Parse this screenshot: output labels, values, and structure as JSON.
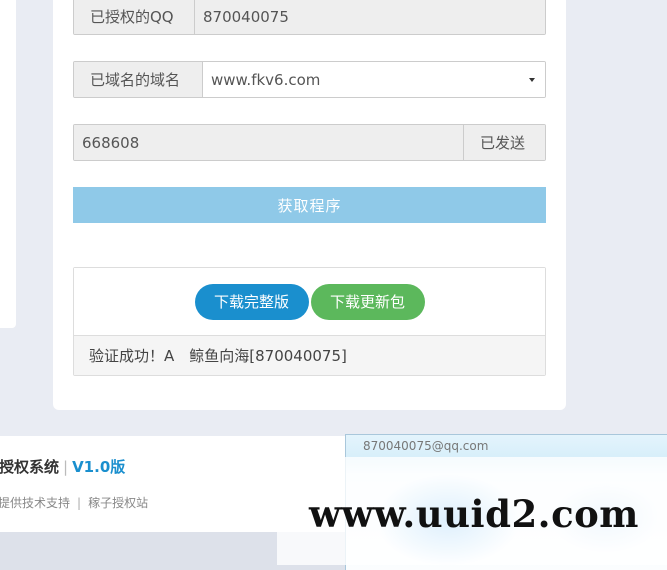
{
  "form": {
    "qq_label": "已授权的QQ",
    "qq_value": "870040075",
    "domain_label": "已域名的域名",
    "domain_value": "www.fkv6.com",
    "code_value": "668608",
    "code_button": "已发送",
    "submit_label": "获取程序"
  },
  "result": {
    "download_full": "下载完整版",
    "download_update": "下载更新包",
    "message": "验证成功！A　鲸鱼向海[870040075]"
  },
  "footer": {
    "title": "授权系统",
    "separator": "|",
    "version": "V1.0版",
    "support": "提供技术支持",
    "link_separator": "|",
    "site": "稼子授权站"
  },
  "popup": {
    "email": "870040075@qq.com"
  },
  "watermark": "www.uuid2.com",
  "colors": {
    "accent_blue": "#1a8fce",
    "success_green": "#5cb85c",
    "submit_disabled": "#8fc9e8",
    "page_bg": "#e9ecf3"
  }
}
